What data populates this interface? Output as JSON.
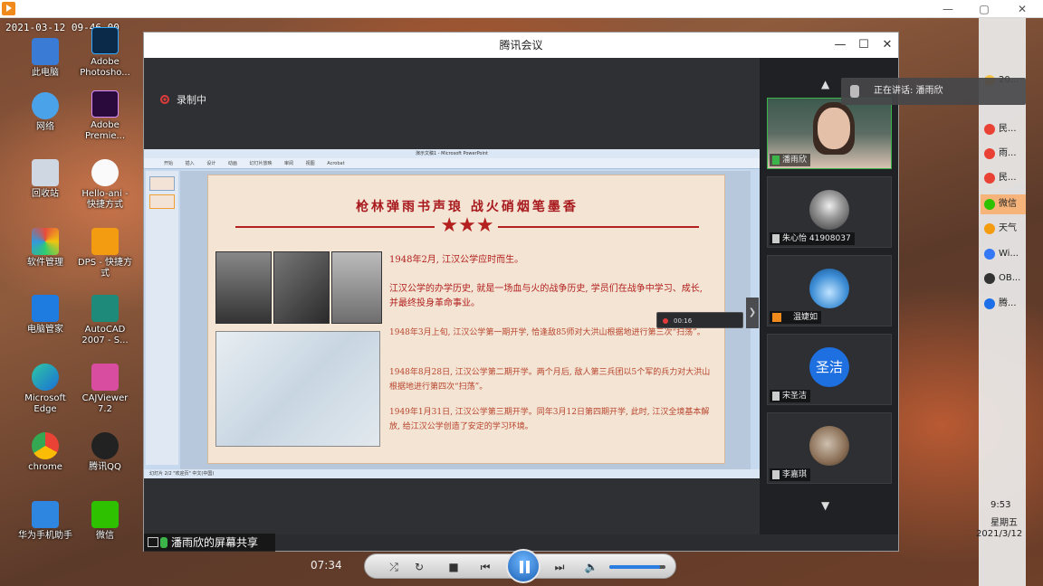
{
  "overlay": {
    "timestamp": "2021-03-12 09-46-00"
  },
  "player": {
    "window_controls": [
      "—",
      "▢",
      "✕"
    ]
  },
  "desktop": {
    "icons": [
      "此电脑",
      "Adobe Photosho...",
      "网络",
      "Adobe Premie...",
      "回收站",
      "Hello-ani - 快捷方式",
      "软件管理",
      "DPS - 快捷方式",
      "电脑管家",
      "AutoCAD 2007 - S...",
      "Microsoft Edge",
      "CAJViewer 7.2",
      "chrome",
      "腾讯QQ",
      "华为手机助手",
      "微信"
    ]
  },
  "taskbar": {
    "items": [
      "20...",
      "民...",
      "雨...",
      "民...",
      "微信",
      "天气",
      "Wi...",
      "OB...",
      "腾..."
    ],
    "time": "9:53",
    "weekday": "星期五",
    "date": "2021/3/12"
  },
  "meeting": {
    "title": "腾讯会议",
    "controls": [
      "—",
      "☐",
      "✕"
    ],
    "recording_label": "录制中",
    "speaking_label": "正在讲话: 潘雨欣",
    "share_banner": "潘雨欣的屏幕共享",
    "participants": [
      {
        "name": "潘雨欣",
        "avatar_text": ""
      },
      {
        "name": "朱心怡 41908037",
        "avatar_text": ""
      },
      {
        "name": "温婕如",
        "avatar_text": ""
      },
      {
        "name": "宋圣洁",
        "avatar_text": "圣洁"
      },
      {
        "name": "李嘉琪",
        "avatar_text": ""
      }
    ]
  },
  "ppt": {
    "window_title": "演示文稿1 - Microsoft PowerPoint",
    "ribbon": [
      "开始",
      "插入",
      "设计",
      "动画",
      "幻灯片放映",
      "审阅",
      "视图",
      "Acrobat"
    ],
    "status": "幻灯片 2/2   \"欢迎页\"   中文(中国)",
    "mini_recorder": "00:16"
  },
  "slide": {
    "title": "枪林弹雨书声琅 战火硝烟笔墨香",
    "stars": "★★★",
    "lines": [
      "1948年2月, 江汉公学应时而生。",
      "江汉公学的办学历史, 就是一场血与火的战争历史, 学员们在战争中学习、成长, 并最终投身革命事业。",
      "1948年3月上旬, 江汉公学第一期开学, 恰逢敌85师对大洪山根据地进行第三次“扫荡”。",
      "1948年8月28日, 江汉公学第二期开学。两个月后, 敌人第三兵团以5个军的兵力对大洪山根据地进行第四次“扫荡”。",
      "1949年1月31日, 江汉公学第三期开学。同年3月12日第四期开学, 此时, 江汉全境基本解放, 给江汉公学创造了安定的学习环境。"
    ]
  },
  "media": {
    "elapsed": "07:34",
    "volume": 0.9
  }
}
